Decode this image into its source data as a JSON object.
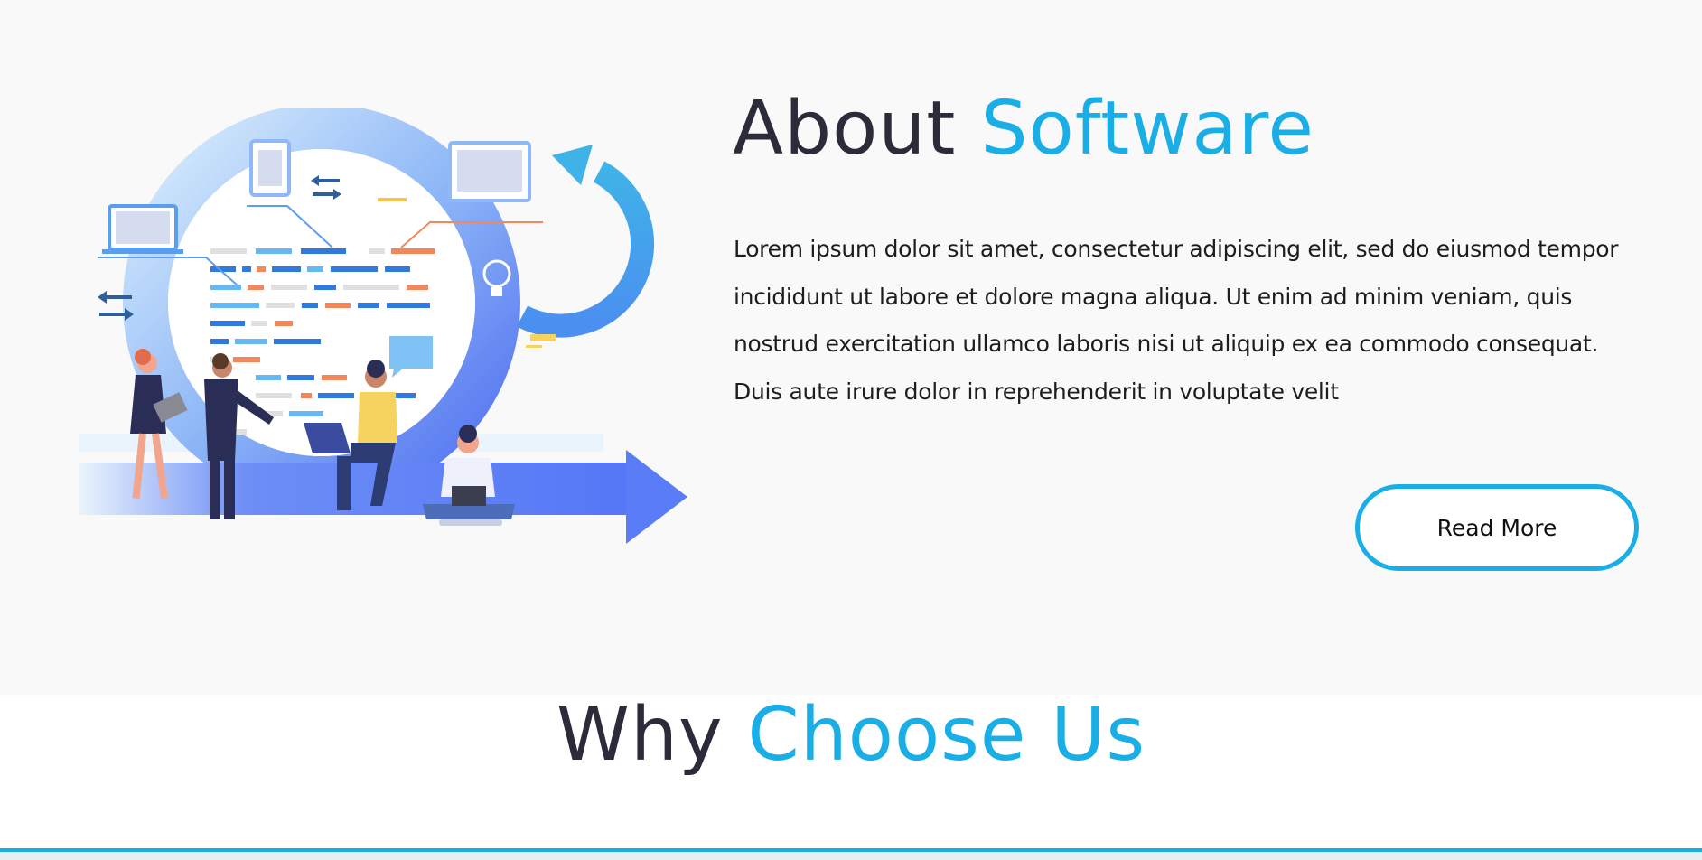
{
  "about": {
    "title_plain": "About",
    "title_accent": "Software",
    "body": "Lorem ipsum dolor sit amet, consectetur adipiscing elit, sed do eiusmod tempor incididunt ut labore et dolore magna aliqua. Ut enim ad minim veniam, quis nostrud exercitation ullamco laboris nisi ut aliquip ex ea commodo consequat. Duis aute irure dolor in reprehenderit in voluptate velit",
    "read_more_label": "Read More",
    "illustration_icon": "software-development-team-illustration"
  },
  "why": {
    "title_plain": "Why",
    "title_accent": "Choose Us"
  },
  "colors": {
    "accent": "#1aaee6",
    "heading": "#2b2b3a",
    "section_bg": "#f9f9f9"
  }
}
